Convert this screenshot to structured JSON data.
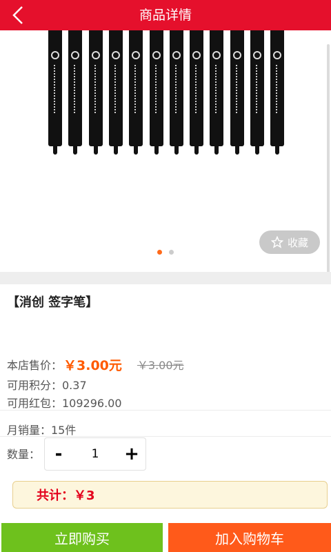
{
  "header": {
    "title": "商品详情",
    "back_icon": "chevron-left-icon"
  },
  "gallery": {
    "pen_count": 12,
    "active_slide": 1,
    "slide_count": 2,
    "favorite_label": "收藏",
    "favorite_icon": "star-outline-icon"
  },
  "product": {
    "name": "【消创 签字笔】"
  },
  "pricing": {
    "price_label": "本店售价：",
    "price": "￥3.00元",
    "original_price": "￥3.00元",
    "points_label": "可用积分：0.37",
    "red_packet_label": "可用红包：109296.00"
  },
  "sales": {
    "monthly_label": "月销量：15件"
  },
  "quantity": {
    "label": "数量：",
    "minus": "-",
    "value": "1",
    "plus": "+"
  },
  "total": {
    "label": "共计：￥3"
  },
  "actions": {
    "buy_now": "立即购买",
    "add_to_cart": "加入购物车"
  },
  "colors": {
    "header": "#e5102c",
    "buy": "#6ec11d",
    "cart": "#ff5a1a",
    "price": "#ff5a00"
  }
}
